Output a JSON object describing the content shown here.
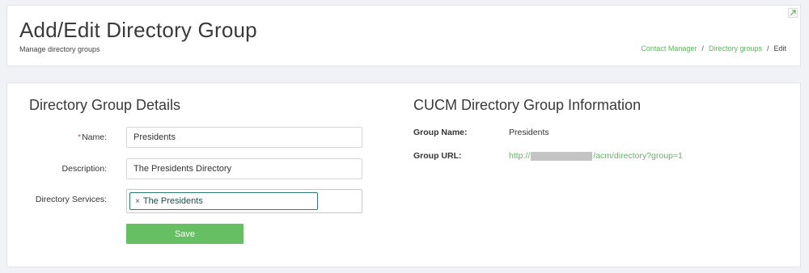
{
  "header": {
    "title": "Add/Edit Directory Group",
    "subtitle": "Manage directory groups",
    "breadcrumb": {
      "item1": "Contact Manager",
      "item2": "Directory groups",
      "current": "Edit",
      "separator": "/"
    },
    "expand_icon": "expand-arrow-icon"
  },
  "details": {
    "title": "Directory Group Details",
    "required_mark": "*",
    "name_label": "Name:",
    "name_value": "Presidents",
    "description_label": "Description:",
    "description_value": "The Presidents Directory",
    "services_label": "Directory Services:",
    "services_selected": "The Presidents",
    "chip_remove": "×",
    "save_label": "Save"
  },
  "cucm": {
    "title": "CUCM Directory Group Information",
    "group_name_label": "Group Name:",
    "group_name_value": "Presidents",
    "group_url_label": "Group URL:",
    "url_prefix": "http://",
    "url_suffix": "/acm/directory?group=1"
  },
  "colors": {
    "accent_green": "#5cb85c",
    "button_green": "#66bf63",
    "required_red": "#d9534f",
    "background": "#f1f2f6"
  }
}
